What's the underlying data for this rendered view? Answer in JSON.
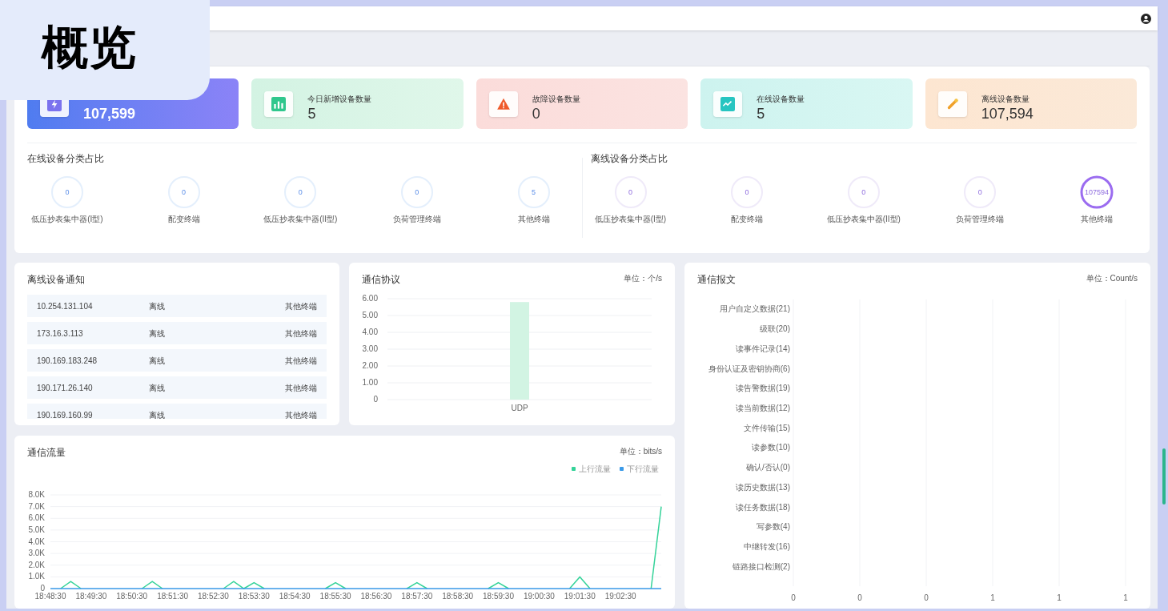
{
  "badge": {
    "title": "概览"
  },
  "stat_cards": [
    {
      "kind": "total",
      "value": "107,599"
    },
    {
      "kind": "new",
      "label": "今日新增设备数量",
      "value": "5"
    },
    {
      "kind": "fault",
      "label": "故障设备数量",
      "value": "0"
    },
    {
      "kind": "online",
      "label": "在线设备数量",
      "value": "5"
    },
    {
      "kind": "offline",
      "label": "离线设备数量",
      "value": "107,594"
    }
  ],
  "online_breakdown": {
    "title": "在线设备分类占比",
    "items": [
      {
        "value": "0",
        "label": "低压抄表集中器(I型)",
        "level": 0
      },
      {
        "value": "0",
        "label": "配变终端",
        "level": 0
      },
      {
        "value": "0",
        "label": "低压抄表集中器(II型)",
        "level": 0
      },
      {
        "value": "0",
        "label": "负荷管理终端",
        "level": 0
      },
      {
        "value": "5",
        "label": "其他终端",
        "level": 0
      }
    ]
  },
  "offline_breakdown": {
    "title": "离线设备分类占比",
    "items": [
      {
        "value": "0",
        "label": "低压抄表集中器(I型)",
        "level": 0
      },
      {
        "value": "0",
        "label": "配变终端",
        "level": 0
      },
      {
        "value": "0",
        "label": "低压抄表集中器(II型)",
        "level": 0
      },
      {
        "value": "0",
        "label": "负荷管理终端",
        "level": 0
      },
      {
        "value": "107594",
        "label": "其他终端",
        "level": 1
      }
    ]
  },
  "offline_notices": {
    "title": "离线设备通知",
    "rows": [
      {
        "ip": "10.254.131.104",
        "status": "离线",
        "type": "其他终端"
      },
      {
        "ip": "173.16.3.113",
        "status": "离线",
        "type": "其他终端"
      },
      {
        "ip": "190.169.183.248",
        "status": "离线",
        "type": "其他终端"
      },
      {
        "ip": "190.171.26.140",
        "status": "离线",
        "type": "其他终端"
      },
      {
        "ip": "190.169.160.99",
        "status": "离线",
        "type": "其他终端"
      }
    ]
  },
  "protocol": {
    "title": "通信协议",
    "unit": "单位：个/s",
    "chart_data": {
      "type": "bar",
      "categories": [
        "UDP"
      ],
      "values": [
        5.8
      ],
      "grid": true,
      "ylim": [
        0,
        6
      ],
      "yticks": [
        {
          "value": 0,
          "label": "0"
        },
        {
          "value": 1,
          "label": "1.00"
        },
        {
          "value": 2,
          "label": "2.00"
        },
        {
          "value": 3,
          "label": "3.00"
        },
        {
          "value": 4,
          "label": "4.00"
        },
        {
          "value": 5,
          "label": "5.00"
        },
        {
          "value": 6,
          "label": "6.00"
        }
      ]
    }
  },
  "messages": {
    "title": "通信报文",
    "unit": "单位：Count/s",
    "chart_data": {
      "type": "bar",
      "orientation": "horizontal",
      "categories": [
        "用户自定义数据(21)",
        "级联(20)",
        "读事件记录(14)",
        "身份认证及密钥协商(6)",
        "读告警数据(19)",
        "读当前数据(12)",
        "文件传输(15)",
        "读参数(10)",
        "确认/否认(0)",
        "读历史数据(13)",
        "读任务数据(18)",
        "写参数(4)",
        "中继转发(16)",
        "链路接口检测(2)"
      ],
      "values": [
        0,
        0,
        0,
        0,
        0,
        0,
        0,
        0,
        0,
        0,
        0,
        0,
        0,
        0
      ],
      "grid": true,
      "xlim": [
        0,
        1
      ],
      "xticks": [
        {
          "value": 0,
          "label": "0"
        },
        {
          "value": 0.2,
          "label": "0"
        },
        {
          "value": 0.4,
          "label": "0"
        },
        {
          "value": 0.6,
          "label": "1"
        },
        {
          "value": 0.8,
          "label": "1"
        },
        {
          "value": 1,
          "label": "1"
        }
      ]
    }
  },
  "traffic": {
    "title": "通信流量",
    "unit": "单位：bits/s",
    "chart_data": {
      "type": "line",
      "grid": true,
      "legend": true,
      "categories": [
        "18:48:30",
        null,
        null,
        null,
        "18:49:30",
        null,
        null,
        null,
        "18:50:30",
        null,
        null,
        null,
        "18:51:30",
        null,
        null,
        null,
        "18:52:30",
        null,
        null,
        null,
        "18:53:30",
        null,
        null,
        null,
        "18:54:30",
        null,
        null,
        null,
        "18:55:30",
        null,
        null,
        null,
        "18:56:30",
        null,
        null,
        null,
        "18:57:30",
        null,
        null,
        null,
        "18:58:30",
        null,
        null,
        null,
        "18:59:30",
        null,
        null,
        null,
        "19:00:30",
        null,
        null,
        null,
        "19:01:30",
        null,
        null,
        null,
        "19:02:30",
        null,
        null,
        null,
        null
      ],
      "series": [
        {
          "name": "上行流量",
          "color": "#34d399",
          "values": [
            null,
            0,
            600,
            0,
            null,
            null,
            null,
            null,
            null,
            0,
            600,
            0,
            null,
            null,
            null,
            null,
            null,
            0,
            600,
            0,
            500,
            0,
            null,
            null,
            null,
            null,
            null,
            0,
            500,
            0,
            null,
            null,
            null,
            null,
            null,
            0,
            500,
            0,
            null,
            null,
            null,
            null,
            null,
            0,
            500,
            0,
            null,
            null,
            null,
            null,
            null,
            0,
            1000,
            0,
            null,
            null,
            null,
            null,
            null,
            0,
            7000
          ]
        },
        {
          "name": "下行流量",
          "color": "#3b9ae8",
          "values": [
            0,
            0,
            0,
            0,
            0,
            0,
            0,
            0,
            0,
            0,
            0,
            0,
            0,
            0,
            0,
            0,
            0,
            0,
            0,
            0,
            0,
            0,
            0,
            0,
            0,
            0,
            0,
            0,
            0,
            0,
            0,
            0,
            0,
            0,
            0,
            0,
            0,
            0,
            0,
            0,
            0,
            0,
            0,
            0,
            0,
            0,
            0,
            0,
            0,
            0,
            0,
            0,
            0,
            0,
            0,
            0,
            0,
            0,
            0,
            0,
            0
          ]
        }
      ],
      "ylim": [
        0,
        8000
      ],
      "yticks": [
        {
          "value": 0,
          "label": "0"
        },
        {
          "value": 1000,
          "label": "1.0K"
        },
        {
          "value": 2000,
          "label": "2.0K"
        },
        {
          "value": 3000,
          "label": "3.0K"
        },
        {
          "value": 4000,
          "label": "4.0K"
        },
        {
          "value": 5000,
          "label": "5.0K"
        },
        {
          "value": 6000,
          "label": "6.0K"
        },
        {
          "value": 7000,
          "label": "7.0K"
        },
        {
          "value": 8000,
          "label": "8.0K"
        }
      ]
    }
  }
}
